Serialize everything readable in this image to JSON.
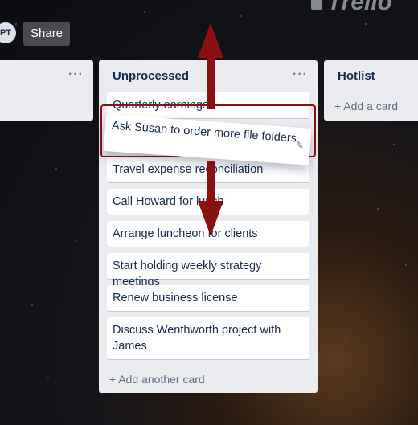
{
  "brand": {
    "logo_text": "Trello"
  },
  "header": {
    "avatar_initials": "PT",
    "share_label": "Share"
  },
  "lists": {
    "left": {
      "menu": "···"
    },
    "main": {
      "title": "Unprocessed",
      "menu": "···",
      "cards": [
        "Quarterly earnings",
        "Travel expense reconciliation",
        "Call Howard for lunch",
        "Arrange luncheon for clients",
        "Start holding weekly strategy meetings",
        "Renew business license",
        "Discuss Wenthworth project with James"
      ],
      "dragging_card": "Ask Susan to order more file folders",
      "add_another": "+ Add another card"
    },
    "right": {
      "title": "Hotlist",
      "add_card": "+ Add a card"
    }
  },
  "colors": {
    "accent_arrow": "#8b1010"
  }
}
